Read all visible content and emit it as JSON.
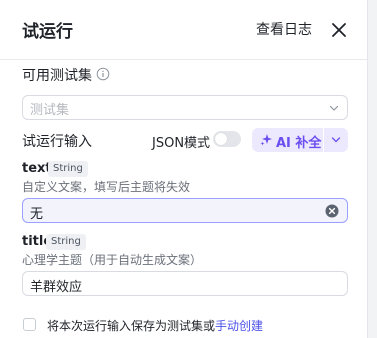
{
  "header": {
    "title": "试运行",
    "view_log": "查看日志"
  },
  "testset": {
    "label": "可用测试集",
    "placeholder": "测试集"
  },
  "run_input": {
    "label": "试运行输入",
    "json_mode_label": "JSON模式",
    "json_mode_on": false,
    "ai_label": "AI 补全"
  },
  "fields": [
    {
      "name": "text",
      "type": "String",
      "description": "自定义文案，填写后主题将失效",
      "value": "无"
    },
    {
      "name": "title",
      "type": "String",
      "description": "心理学主题（用于自动生成文案）",
      "value": "羊群效应"
    }
  ],
  "footer": {
    "save_text": "将本次运行输入保存为测试集或",
    "manual_link": "手动创建",
    "checked": false
  },
  "colors": {
    "accent": "#4d53e8",
    "ai_purple": "#6b4ef0",
    "ai_bg": "#ece8fe"
  }
}
